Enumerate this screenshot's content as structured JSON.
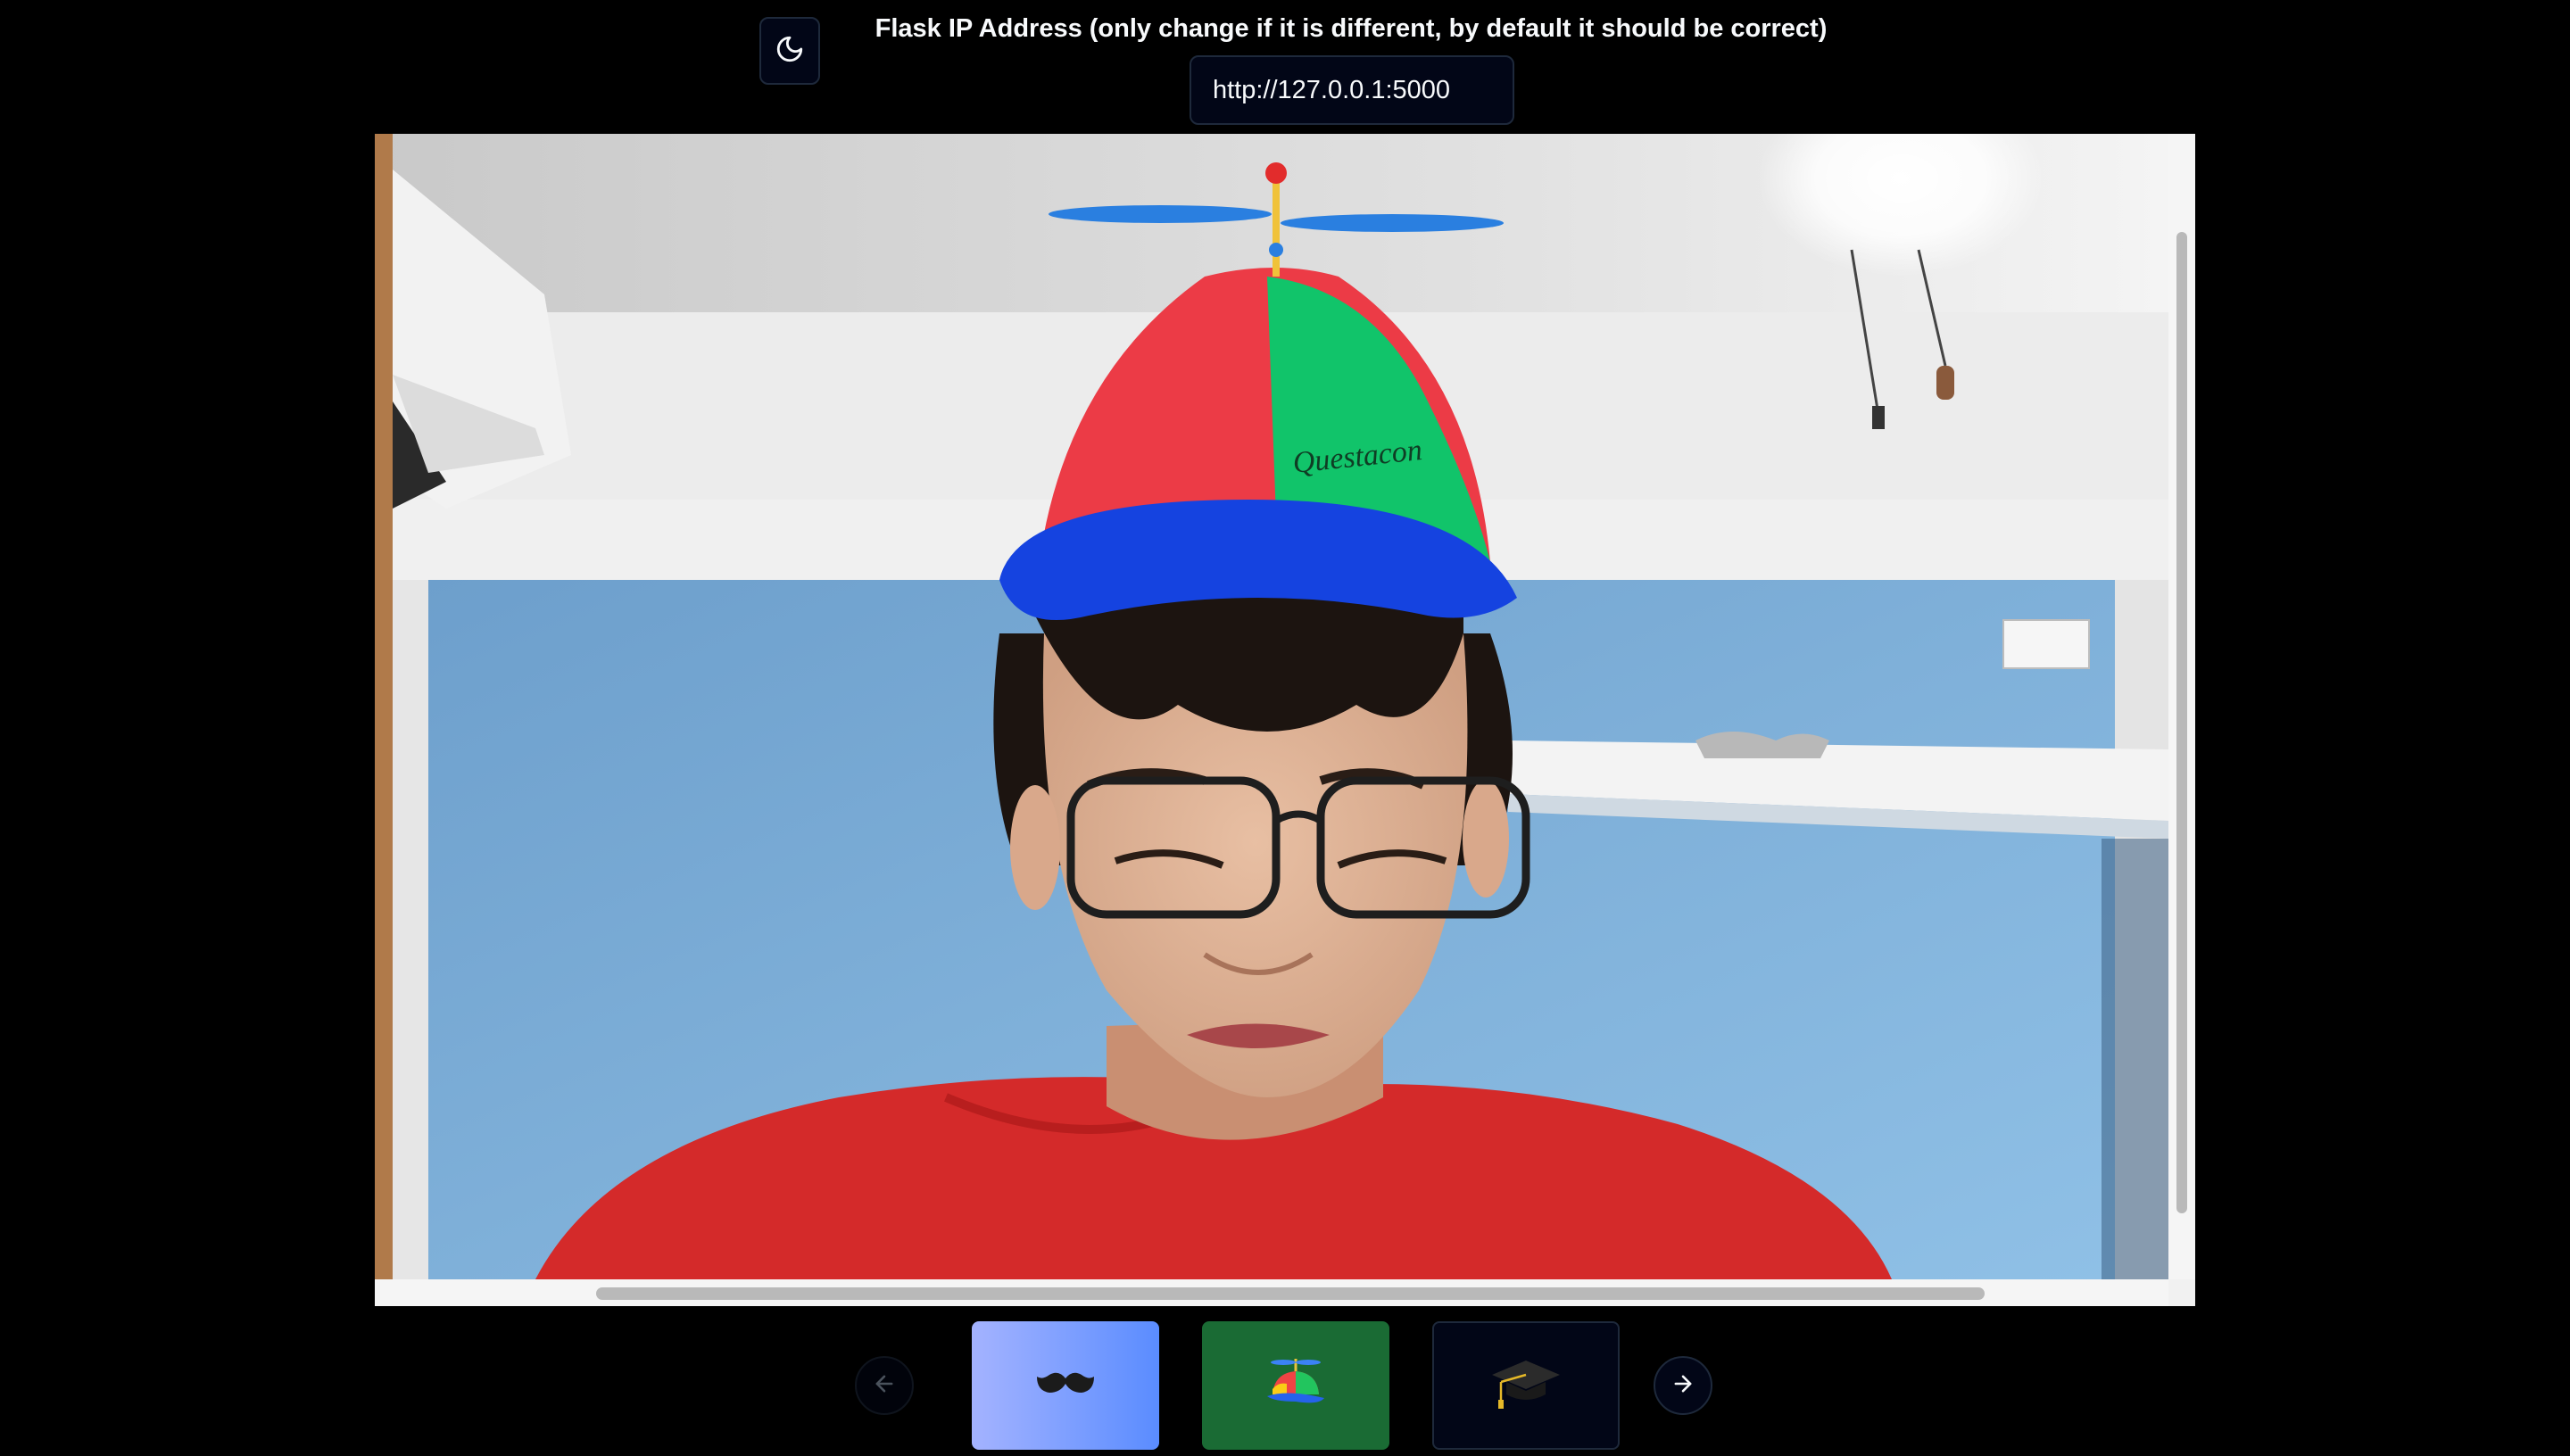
{
  "header": {
    "theme_toggle_icon": "moon-icon",
    "ip_label": "Flask IP Address (only change if it is different, by default it should be correct)",
    "ip_value": "http://127.0.0.1:5000"
  },
  "video": {
    "overlay_filter": "propeller-hat",
    "cap_text": "Questacon"
  },
  "carousel": {
    "prev_icon": "arrow-left-icon",
    "next_icon": "arrow-right-icon",
    "filters": [
      {
        "icon": "mustache-icon",
        "background": "#8aa5ff"
      },
      {
        "icon": "propeller-hat-icon",
        "background": "#1a6b34"
      },
      {
        "icon": "graduation-cap-icon",
        "background": "#020617"
      }
    ]
  },
  "colors": {
    "page_background": "#000000",
    "input_background": "#020617",
    "border": "#1e293b",
    "text": "#f8fafc"
  }
}
